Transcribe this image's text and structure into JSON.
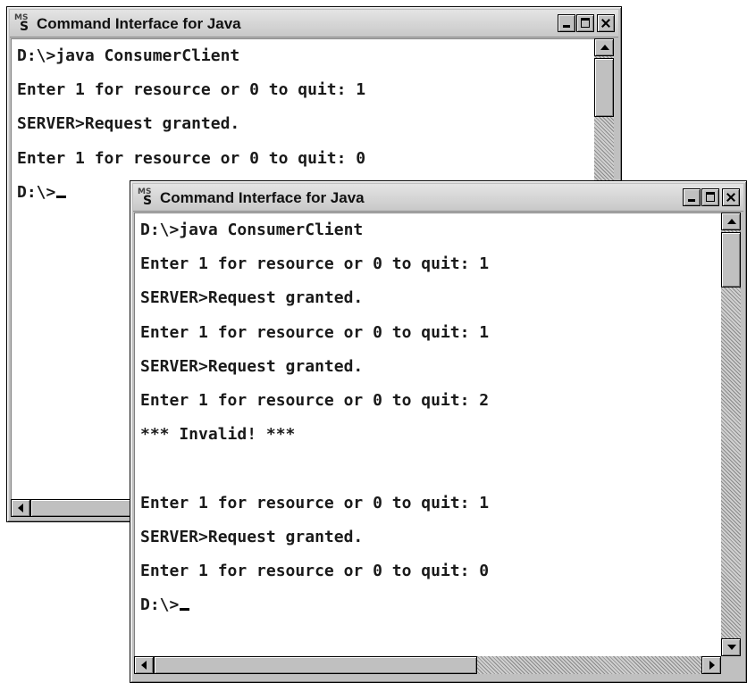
{
  "back_window": {
    "title": "Command Interface for Java",
    "icon": "ms-dos-icon",
    "lines": [
      "D:\\>java ConsumerClient",
      "Enter 1 for resource or 0 to quit: 1",
      "SERVER>Request granted.",
      "Enter 1 for resource or 0 to quit: 0",
      "D:\\>"
    ]
  },
  "front_window": {
    "title": "Command Interface for Java",
    "icon": "ms-dos-icon",
    "lines": [
      "D:\\>java ConsumerClient",
      "Enter 1 for resource or 0 to quit: 1",
      "SERVER>Request granted.",
      "Enter 1 for resource or 0 to quit: 1",
      "SERVER>Request granted.",
      "Enter 1 for resource or 0 to quit: 2",
      "*** Invalid! ***",
      "",
      "Enter 1 for resource or 0 to quit: 1",
      "SERVER>Request granted.",
      "Enter 1 for resource or 0 to quit: 0",
      "D:\\>"
    ]
  }
}
